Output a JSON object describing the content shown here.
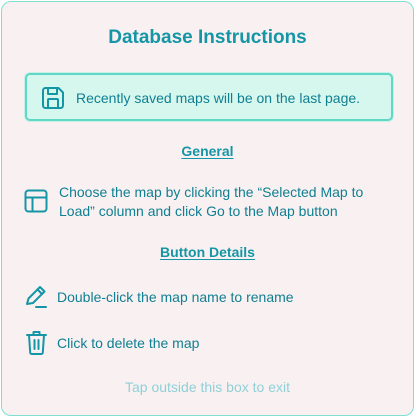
{
  "dialog": {
    "title": "Database Instructions",
    "notice": {
      "icon": "floppy-disk-icon",
      "text": "Recently saved maps will be on the last page."
    },
    "general": {
      "heading": "General",
      "icon": "table-layout-icon",
      "text": "Choose the map by clicking the “Selected Map to Load” column and click Go to the Map button"
    },
    "button_details": {
      "heading": "Button Details",
      "rename": {
        "icon": "pencil-icon",
        "text": "Double-click the map name to rename"
      },
      "delete": {
        "icon": "trash-icon",
        "text": "Click to delete the map"
      }
    },
    "footer": "Tap outside this box to exit"
  },
  "colors": {
    "accent": "#1596a6",
    "text": "#0f7f92",
    "panel_background": "#f9f1f1",
    "panel_border": "#7fe0d2",
    "notice_background": "#d6f7ee",
    "notice_border": "#5fd8c6",
    "footer_text": "#8fd0d8"
  }
}
